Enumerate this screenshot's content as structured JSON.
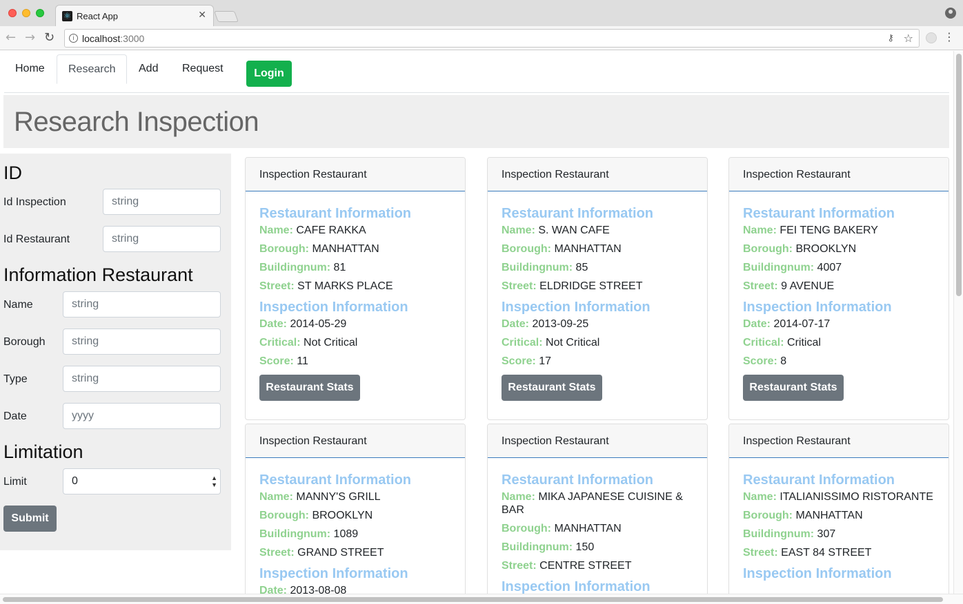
{
  "browser": {
    "tab_title": "React App",
    "url_host": "localhost",
    "url_port": ":3000"
  },
  "nav": {
    "items": [
      "Home",
      "Research",
      "Add",
      "Request"
    ],
    "active": "Research",
    "login_label": "Login"
  },
  "page_title": "Research Inspection",
  "search_form": {
    "id_heading": "ID",
    "id_inspection_label": "Id Inspection",
    "id_inspection_placeholder": "string",
    "id_restaurant_label": "Id Restaurant",
    "id_restaurant_placeholder": "string",
    "info_heading": "Information Restaurant",
    "name_label": "Name",
    "name_placeholder": "string",
    "borough_label": "Borough",
    "borough_placeholder": "string",
    "type_label": "Type",
    "type_placeholder": "string",
    "date_label": "Date",
    "date_placeholder": "yyyy",
    "limit_heading": "Limitation",
    "limit_label": "Limit",
    "limit_value": "0",
    "submit_label": "Submit"
  },
  "card_labels": {
    "header": "Inspection Restaurant",
    "restaurant_info": "Restaurant Information",
    "inspection_info": "Inspection Information",
    "name": "Name:",
    "borough": "Borough:",
    "buildingnum": "Buildingnum:",
    "street": "Street:",
    "date": "Date:",
    "critical": "Critical:",
    "score": "Score:",
    "stats_button": "Restaurant Stats"
  },
  "cards": [
    {
      "name": "CAFE RAKKA",
      "borough": "MANHATTAN",
      "buildingnum": "81",
      "street": "ST MARKS PLACE",
      "date": "2014-05-29",
      "critical": "Not Critical",
      "score": "11"
    },
    {
      "name": "S. WAN CAFE",
      "borough": "MANHATTAN",
      "buildingnum": "85",
      "street": "ELDRIDGE STREET",
      "date": "2013-09-25",
      "critical": "Not Critical",
      "score": "17"
    },
    {
      "name": "FEI TENG BAKERY",
      "borough": "BROOKLYN",
      "buildingnum": "4007",
      "street": "9 AVENUE",
      "date": "2014-07-17",
      "critical": "Critical",
      "score": "8"
    },
    {
      "name": "MANNY'S GRILL",
      "borough": "BROOKLYN",
      "buildingnum": "1089",
      "street": "GRAND STREET",
      "date": "2013-08-08",
      "critical": "",
      "score": ""
    },
    {
      "name": "MIKA JAPANESE CUISINE & BAR",
      "borough": "MANHATTAN",
      "buildingnum": "150",
      "street": "CENTRE STREET",
      "date": "",
      "critical": "",
      "score": ""
    },
    {
      "name": "ITALIANISSIMO RISTORANTE",
      "borough": "MANHATTAN",
      "buildingnum": "307",
      "street": "EAST 84 STREET",
      "date": "",
      "critical": "",
      "score": ""
    }
  ]
}
